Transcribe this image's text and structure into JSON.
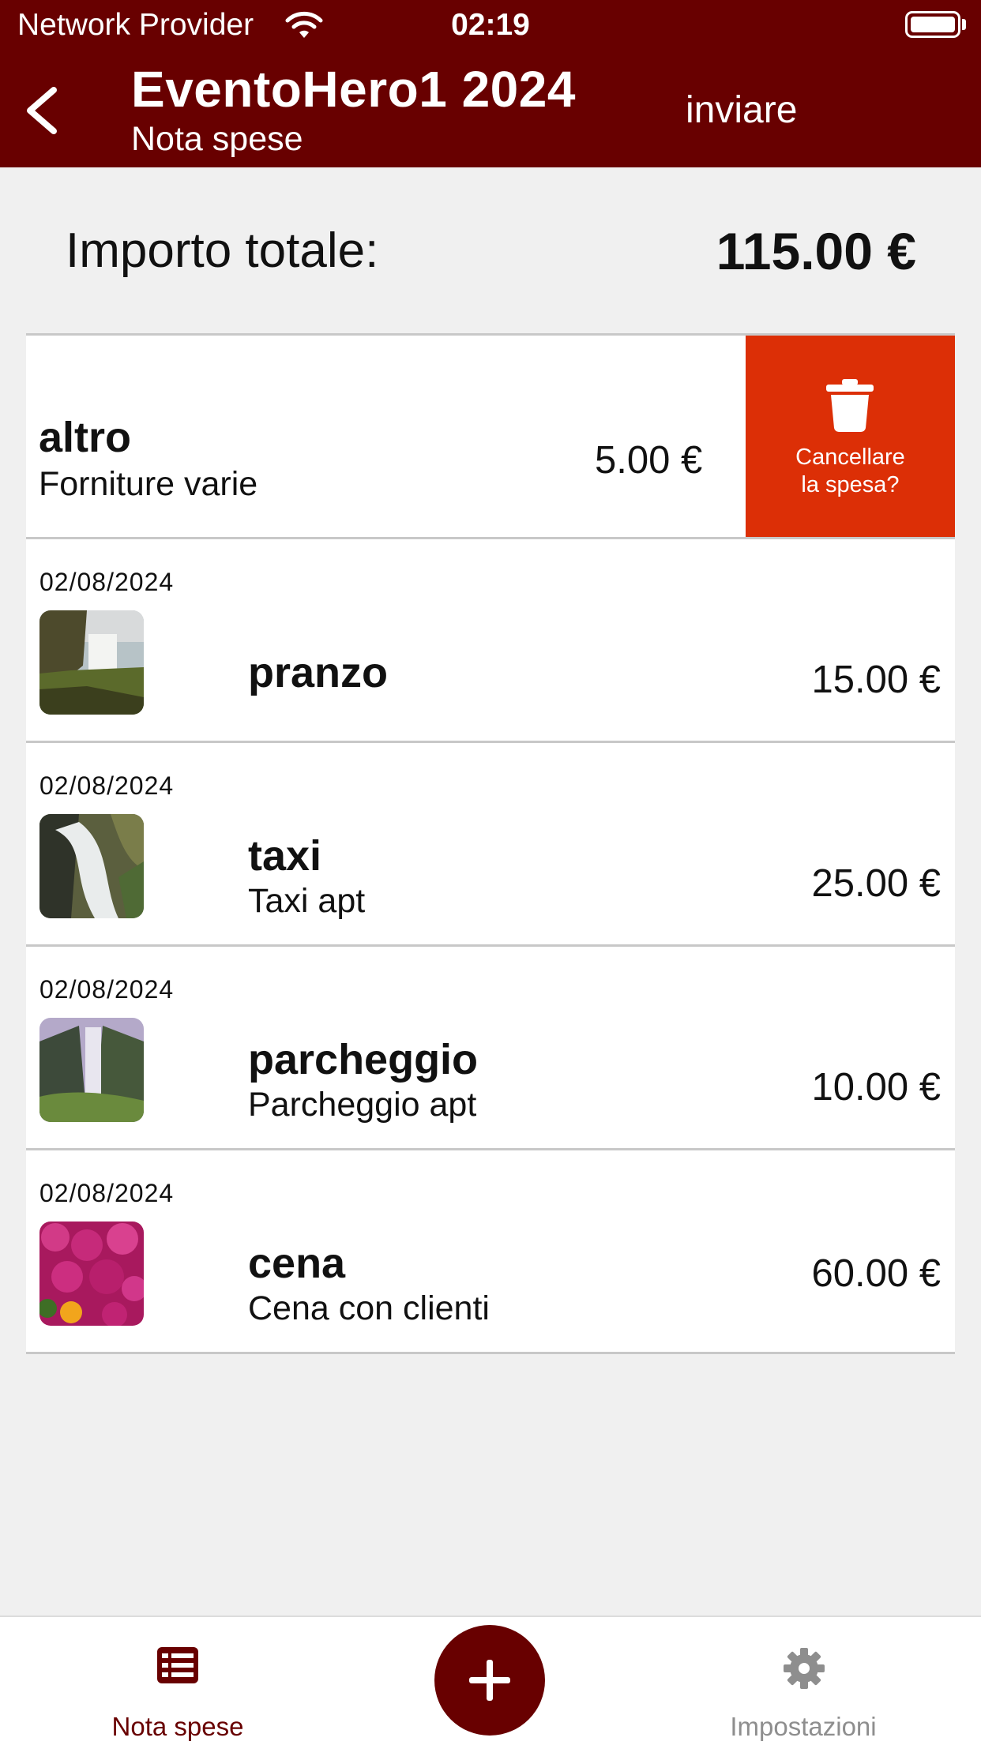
{
  "status_bar": {
    "carrier": "Network Provider",
    "time": "02:19"
  },
  "header": {
    "title": "EventoHero1 2024",
    "subtitle": "Nota spese",
    "send_label": "inviare"
  },
  "summary": {
    "label": "Importo totale:",
    "value": "115.00 €"
  },
  "swiped_item": {
    "name": "altro",
    "note": "Forniture varie",
    "amount": "5.00 €",
    "delete_label_line1": "Cancellare",
    "delete_label_line2": "la spesa?"
  },
  "expenses": [
    {
      "date": "02/08/2024",
      "name": "pranzo",
      "note": "",
      "amount": "15.00 €",
      "thumb": "waterfall-cliff"
    },
    {
      "date": "02/08/2024",
      "name": "taxi",
      "note": "Taxi apt",
      "amount": "25.00 €",
      "thumb": "waterfall-rocks"
    },
    {
      "date": "02/08/2024",
      "name": "parcheggio",
      "note": "Parcheggio apt",
      "amount": "10.00 €",
      "thumb": "waterfall-mist"
    },
    {
      "date": "02/08/2024",
      "name": "cena",
      "note": "Cena con clienti",
      "amount": "60.00 €",
      "thumb": "pink-flowers"
    }
  ],
  "tabbar": {
    "home_label": "Nota spese",
    "settings_label": "Impostazioni"
  },
  "colors": {
    "brand": "#680000",
    "delete": "#dc2f06",
    "background": "#f0f0f0"
  }
}
